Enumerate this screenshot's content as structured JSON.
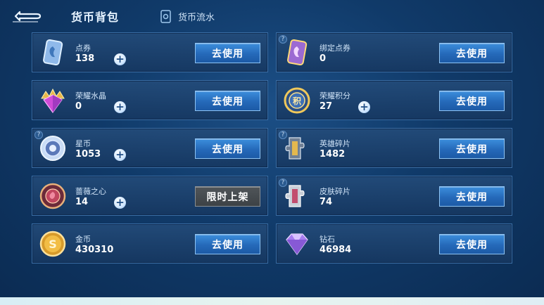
{
  "header": {
    "title": "货币背包",
    "flow_tab": "货币流水"
  },
  "colors": {
    "button_blue": "#2569b9",
    "button_disabled": "#4a4f53",
    "card_bg": "#1f4e84",
    "card_border": "#3a6da4"
  },
  "currencies": [
    {
      "name": "点券",
      "amount": "138",
      "icon": "ticket-icon",
      "has_plus": true,
      "has_help": false,
      "button": "去使用",
      "button_enabled": true
    },
    {
      "name": "绑定点券",
      "amount": "0",
      "icon": "bound-ticket-icon",
      "has_plus": false,
      "has_help": true,
      "button": "去使用",
      "button_enabled": true
    },
    {
      "name": "荣耀水晶",
      "amount": "0",
      "icon": "glory-crystal-icon",
      "has_plus": true,
      "has_help": false,
      "button": "去使用",
      "button_enabled": true
    },
    {
      "name": "荣耀积分",
      "amount": "27",
      "icon": "glory-points-icon",
      "has_plus": true,
      "has_help": false,
      "button": "去使用",
      "button_enabled": true
    },
    {
      "name": "星币",
      "amount": "1053",
      "icon": "star-coin-icon",
      "has_plus": true,
      "has_help": true,
      "button": "去使用",
      "button_enabled": true
    },
    {
      "name": "英雄碎片",
      "amount": "1482",
      "icon": "hero-fragment-icon",
      "has_plus": false,
      "has_help": true,
      "button": "去使用",
      "button_enabled": true
    },
    {
      "name": "蔷薇之心",
      "amount": "14",
      "icon": "rose-heart-icon",
      "has_plus": true,
      "has_help": false,
      "button": "限时上架",
      "button_enabled": false
    },
    {
      "name": "皮肤碎片",
      "amount": "74",
      "icon": "skin-fragment-icon",
      "has_plus": false,
      "has_help": true,
      "button": "去使用",
      "button_enabled": true
    },
    {
      "name": "金币",
      "amount": "430310",
      "icon": "gold-coin-icon",
      "has_plus": false,
      "has_help": false,
      "button": "去使用",
      "button_enabled": true
    },
    {
      "name": "钻石",
      "amount": "46984",
      "icon": "diamond-icon",
      "has_plus": false,
      "has_help": false,
      "button": "去使用",
      "button_enabled": true
    }
  ]
}
